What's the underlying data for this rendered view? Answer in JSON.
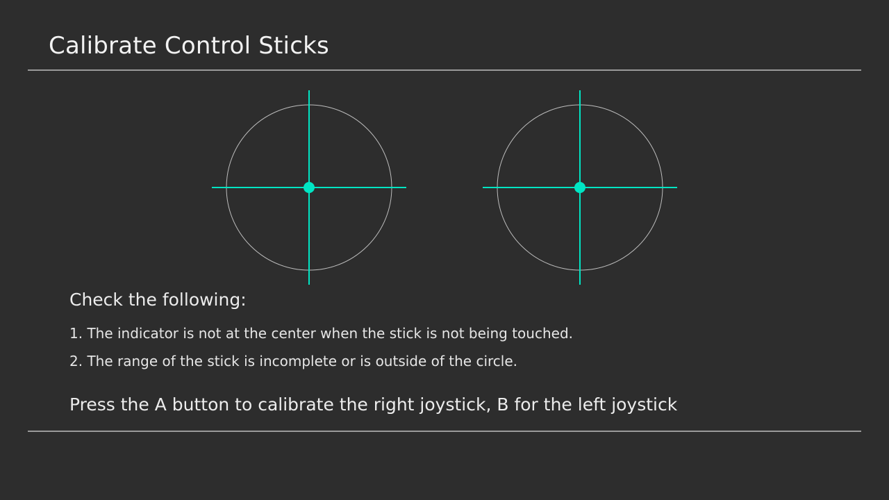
{
  "header": {
    "title": "Calibrate Control Sticks"
  },
  "sticks": {
    "accent_color": "#00e5c3",
    "ring_color": "#bdbdbd",
    "left": {
      "x": 0,
      "y": 0
    },
    "right": {
      "x": 0,
      "y": 0
    }
  },
  "checklist": {
    "heading": "Check the following:",
    "items": [
      "1. The indicator is not at the center when the stick is not being touched.",
      "2. The range of the stick is incomplete or is outside of the circle."
    ]
  },
  "instruction": "Press the A button to calibrate the right joystick, B for the left joystick"
}
